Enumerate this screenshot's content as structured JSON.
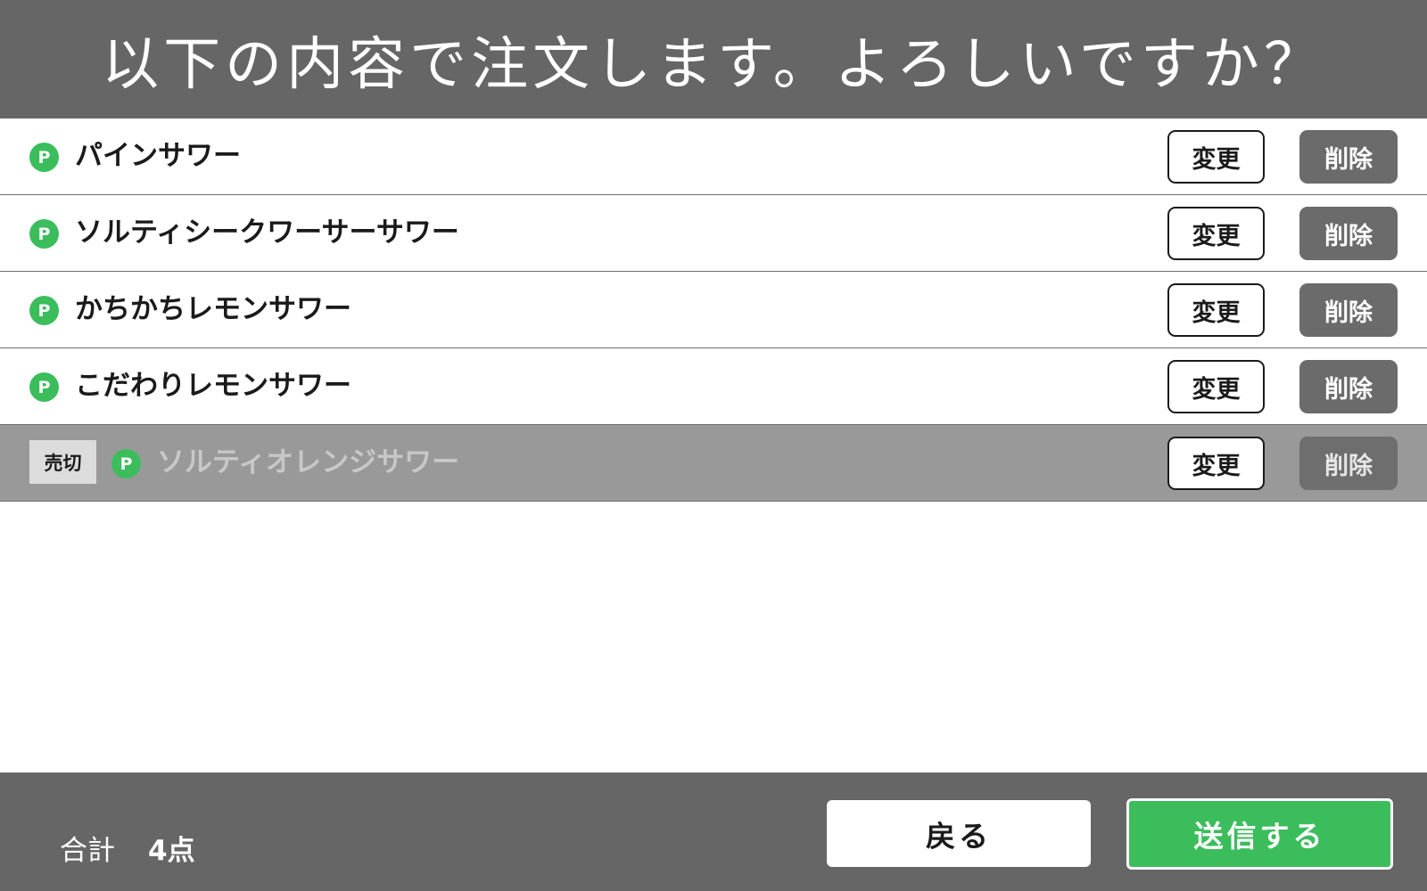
{
  "header": {
    "title": "以下の内容で注文します。よろしいですか？"
  },
  "colors": {
    "header_bg": "#666666",
    "accent_green": "#3bbd5c",
    "soldout_row_bg": "#999999",
    "delete_button_bg": "#6b6b6b"
  },
  "order_items": [
    {
      "name": "パインサワー",
      "icon_label": "P",
      "icon": "point-p-icon",
      "change_label": "変更",
      "delete_label": "削除",
      "sold_out": false
    },
    {
      "name": "ソルティシークワーサーサワー",
      "icon_label": "P",
      "icon": "point-p-icon",
      "change_label": "変更",
      "delete_label": "削除",
      "sold_out": false
    },
    {
      "name": "かちかちレモンサワー",
      "icon_label": "P",
      "icon": "point-p-icon",
      "change_label": "変更",
      "delete_label": "削除",
      "sold_out": false
    },
    {
      "name": "こだわりレモンサワー",
      "icon_label": "P",
      "icon": "point-p-icon",
      "change_label": "変更",
      "delete_label": "削除",
      "sold_out": false
    },
    {
      "name": "ソルティオレンジサワー",
      "icon_label": "P",
      "icon": "point-p-icon",
      "change_label": "変更",
      "delete_label": "削除",
      "sold_out": true,
      "soldout_badge": "売切"
    }
  ],
  "footer": {
    "total_label": "合計",
    "total_value": "4点",
    "back_label": "戻る",
    "send_label": "送信する"
  }
}
